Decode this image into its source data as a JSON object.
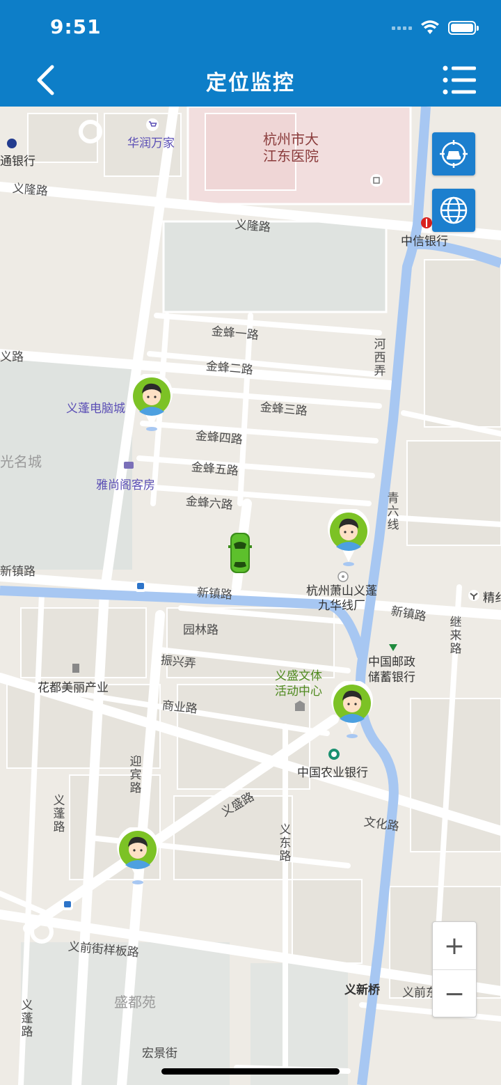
{
  "status_bar": {
    "time": "9:51"
  },
  "header": {
    "title": "定位监控"
  },
  "map_controls": {
    "zoom_in": "+",
    "zoom_out": "−"
  },
  "map_labels": {
    "hospital": "杭州市大\n江东医院",
    "huarun": "华润万家",
    "bank_left": "通银行",
    "yilong_road_left": "义隆路",
    "yilong_road": "义隆路",
    "citic_bank": "中信银行",
    "jinfeng1": "金蜂一路",
    "jinfeng2": "金蜂二路",
    "jinfeng3": "金蜂三路",
    "jinfeng4": "金蜂四路",
    "jinfeng5": "金蜂五路",
    "jinfeng6": "金蜂六路",
    "hexi": "河西弄",
    "yi_road_left": "义路",
    "yipeng_computer": "义蓬电脑城",
    "mingcheng": "光名城",
    "yashang_hotel": "雅尚阁客房",
    "qingliu": "青六线",
    "xinzhen_left": "新镇路",
    "xinzhen_mid": "新镇路",
    "xinzhen_right": "新镇路",
    "jiuhua_factory": "杭州萧山义蓬\n九华线厂",
    "jing": "精纟",
    "yuanlin": "园林路",
    "zhenxing": "振兴弄",
    "jilai": "继来路",
    "postal_bank": "中国邮政\n储蓄银行",
    "yisheng_center": "义盛文体\n活动中心",
    "huadu": "花都美丽产业",
    "shangye": "商业路",
    "yingbin": "迎宾路",
    "abc_bank": "中国农业银行",
    "yipeng_road": "义蓬路",
    "yisheng_road": "义盛路",
    "wenhua": "文化路",
    "yidong": "义东路",
    "yiqianjie": "义前街样板路",
    "yixin_bridge": "义新桥",
    "yiqian_right": "义前东",
    "yipeng_road2": "义蓬路",
    "shengduyuan": "盛都苑",
    "hongjing": "宏景街"
  },
  "colors": {
    "header": "#0d7ec8",
    "water": "#a7c7f2",
    "road": "#ffffff",
    "block": "#e4e1da",
    "car": "#4fae24",
    "pin_ring": "#7cc225"
  },
  "icons": {
    "back": "chevron-left-icon",
    "menu": "list-menu-icon",
    "car_center": "car-locate-icon",
    "globe": "globe-icon"
  }
}
